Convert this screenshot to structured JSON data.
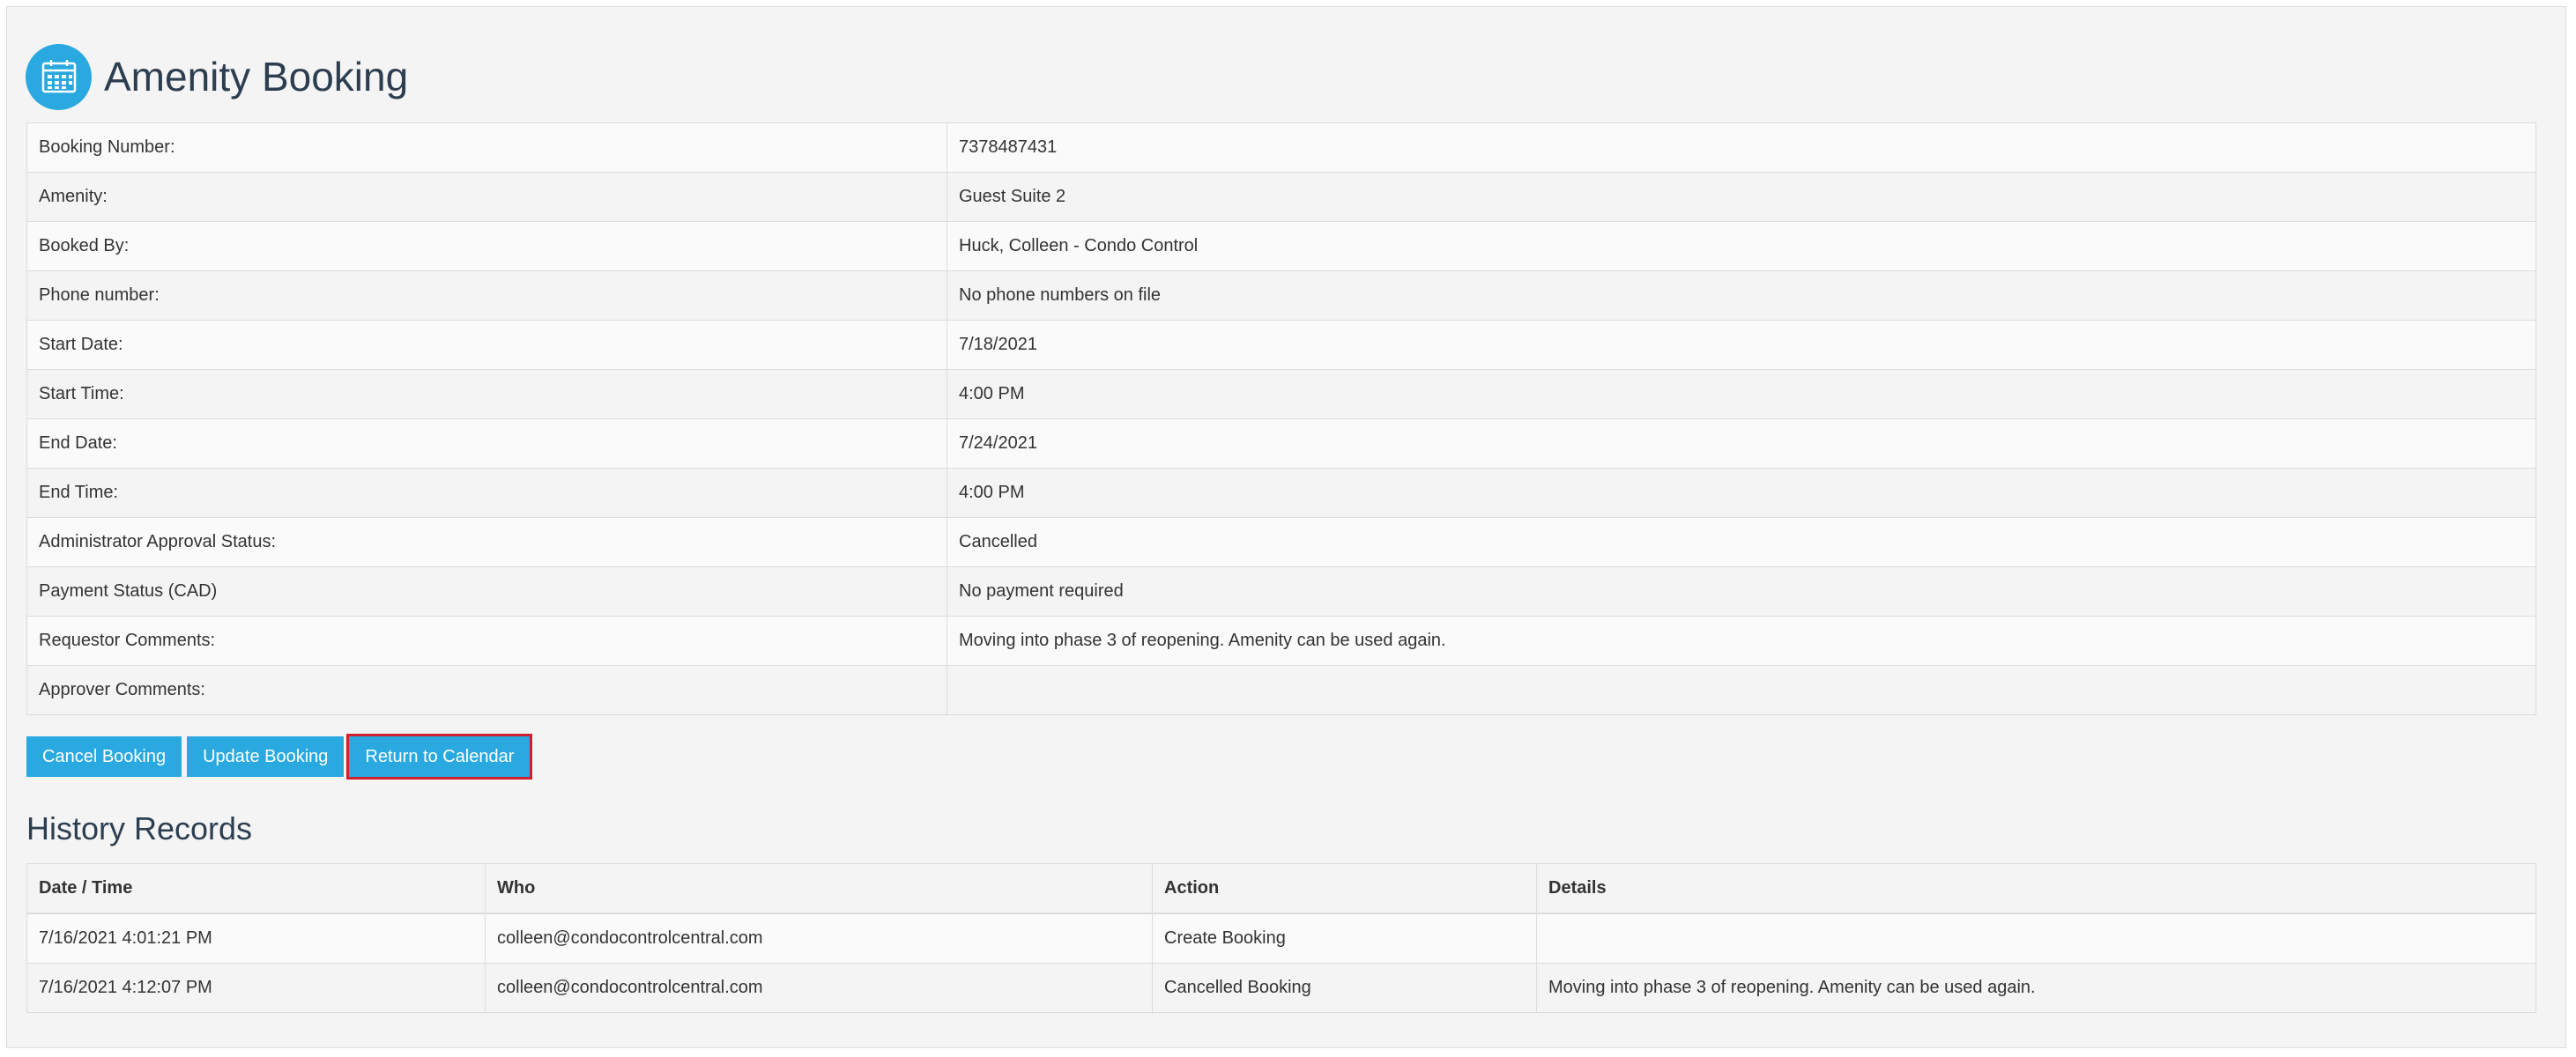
{
  "page": {
    "title": "Amenity Booking",
    "icon": "calendar-icon",
    "accent_color": "#29a9df"
  },
  "details": [
    {
      "label": "Booking Number:",
      "value": "7378487431"
    },
    {
      "label": "Amenity:",
      "value": "Guest Suite 2"
    },
    {
      "label": "Booked By:",
      "value": "Huck, Colleen - Condo Control"
    },
    {
      "label": "Phone number:",
      "value": "No phone numbers on file"
    },
    {
      "label": "Start Date:",
      "value": "7/18/2021"
    },
    {
      "label": "Start Time:",
      "value": "4:00 PM"
    },
    {
      "label": "End Date:",
      "value": "7/24/2021"
    },
    {
      "label": "End Time:",
      "value": "4:00 PM"
    },
    {
      "label": "Administrator Approval Status:",
      "value": "Cancelled"
    },
    {
      "label": "Payment Status (CAD)",
      "value": "No payment required"
    },
    {
      "label": "Requestor Comments:",
      "value": "Moving into phase 3 of reopening. Amenity can be used again."
    },
    {
      "label": "Approver Comments:",
      "value": ""
    }
  ],
  "buttons": {
    "cancel": "Cancel Booking",
    "update": "Update Booking",
    "return": "Return to Calendar"
  },
  "history": {
    "title": "History Records",
    "columns": [
      "Date / Time",
      "Who",
      "Action",
      "Details"
    ],
    "rows": [
      [
        "7/16/2021 4:01:21 PM",
        "colleen@condocontrolcentral.com",
        "Create Booking",
        ""
      ],
      [
        "7/16/2021 4:12:07 PM",
        "colleen@condocontrolcentral.com",
        "Cancelled Booking",
        "Moving into phase 3 of reopening. Amenity can be used again."
      ]
    ]
  }
}
